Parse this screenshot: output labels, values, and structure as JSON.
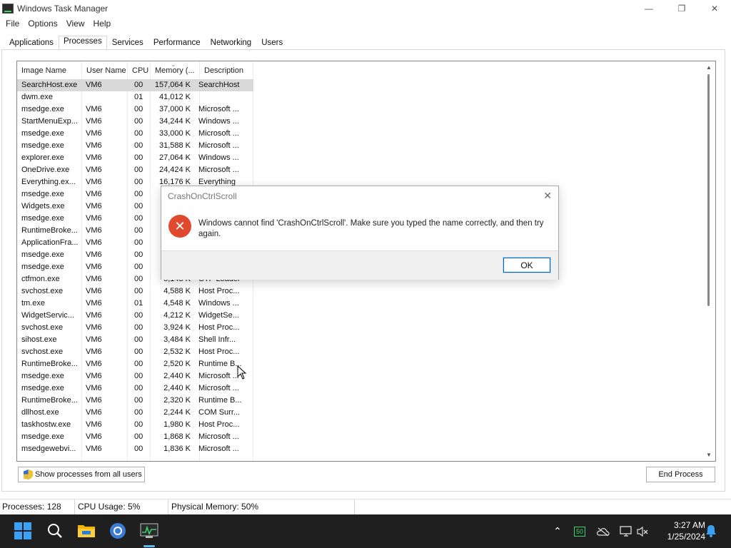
{
  "window": {
    "title": "Windows Task Manager",
    "controls": {
      "minimize": "—",
      "maximize": "❐",
      "close": "✕"
    }
  },
  "menu": [
    "File",
    "Options",
    "View",
    "Help"
  ],
  "tabs": [
    "Applications",
    "Processes",
    "Services",
    "Performance",
    "Networking",
    "Users"
  ],
  "active_tab": "Processes",
  "columns": {
    "image_name": "Image Name",
    "user_name": "User Name",
    "cpu": "CPU",
    "memory": "Memory (...",
    "description": "Description"
  },
  "processes": [
    {
      "name": "SearchHost.exe",
      "user": "VM6",
      "cpu": "00",
      "mem": "157,064 K",
      "desc": "SearchHost",
      "selected": true
    },
    {
      "name": "dwm.exe",
      "user": "",
      "cpu": "01",
      "mem": "41,012 K",
      "desc": ""
    },
    {
      "name": "msedge.exe",
      "user": "VM6",
      "cpu": "00",
      "mem": "37,000 K",
      "desc": "Microsoft ..."
    },
    {
      "name": "StartMenuExp...",
      "user": "VM6",
      "cpu": "00",
      "mem": "34,244 K",
      "desc": "Windows ..."
    },
    {
      "name": "msedge.exe",
      "user": "VM6",
      "cpu": "00",
      "mem": "33,000 K",
      "desc": "Microsoft ..."
    },
    {
      "name": "msedge.exe",
      "user": "VM6",
      "cpu": "00",
      "mem": "31,588 K",
      "desc": "Microsoft ..."
    },
    {
      "name": "explorer.exe",
      "user": "VM6",
      "cpu": "00",
      "mem": "27,064 K",
      "desc": "Windows ..."
    },
    {
      "name": "OneDrive.exe",
      "user": "VM6",
      "cpu": "00",
      "mem": "24,424 K",
      "desc": "Microsoft ..."
    },
    {
      "name": "Everything.ex...",
      "user": "VM6",
      "cpu": "00",
      "mem": "16,176 K",
      "desc": "Everything"
    },
    {
      "name": "msedge.exe",
      "user": "VM6",
      "cpu": "00",
      "mem": "",
      "desc": ""
    },
    {
      "name": "Widgets.exe",
      "user": "VM6",
      "cpu": "00",
      "mem": "",
      "desc": ""
    },
    {
      "name": "msedge.exe",
      "user": "VM6",
      "cpu": "00",
      "mem": "",
      "desc": ""
    },
    {
      "name": "RuntimeBroke...",
      "user": "VM6",
      "cpu": "00",
      "mem": "",
      "desc": ""
    },
    {
      "name": "ApplicationFra...",
      "user": "VM6",
      "cpu": "00",
      "mem": "",
      "desc": ""
    },
    {
      "name": "msedge.exe",
      "user": "VM6",
      "cpu": "00",
      "mem": "",
      "desc": ""
    },
    {
      "name": "msedge.exe",
      "user": "VM6",
      "cpu": "00",
      "mem": "",
      "desc": ""
    },
    {
      "name": "ctfmon.exe",
      "user": "VM6",
      "cpu": "00",
      "mem": "5,148 K",
      "desc": "CTF Loader"
    },
    {
      "name": "svchost.exe",
      "user": "VM6",
      "cpu": "00",
      "mem": "4,588 K",
      "desc": "Host Proc..."
    },
    {
      "name": "tm.exe",
      "user": "VM6",
      "cpu": "01",
      "mem": "4,548 K",
      "desc": "Windows ..."
    },
    {
      "name": "WidgetServic...",
      "user": "VM6",
      "cpu": "00",
      "mem": "4,212 K",
      "desc": "WidgetSe..."
    },
    {
      "name": "svchost.exe",
      "user": "VM6",
      "cpu": "00",
      "mem": "3,924 K",
      "desc": "Host Proc..."
    },
    {
      "name": "sihost.exe",
      "user": "VM6",
      "cpu": "00",
      "mem": "3,484 K",
      "desc": "Shell Infr..."
    },
    {
      "name": "svchost.exe",
      "user": "VM6",
      "cpu": "00",
      "mem": "2,532 K",
      "desc": "Host Proc..."
    },
    {
      "name": "RuntimeBroke...",
      "user": "VM6",
      "cpu": "00",
      "mem": "2,520 K",
      "desc": "Runtime B..."
    },
    {
      "name": "msedge.exe",
      "user": "VM6",
      "cpu": "00",
      "mem": "2,440 K",
      "desc": "Microsoft ..."
    },
    {
      "name": "msedge.exe",
      "user": "VM6",
      "cpu": "00",
      "mem": "2,440 K",
      "desc": "Microsoft ..."
    },
    {
      "name": "RuntimeBroke...",
      "user": "VM6",
      "cpu": "00",
      "mem": "2,320 K",
      "desc": "Runtime B..."
    },
    {
      "name": "dllhost.exe",
      "user": "VM6",
      "cpu": "00",
      "mem": "2,244 K",
      "desc": "COM Surr..."
    },
    {
      "name": "taskhostw.exe",
      "user": "VM6",
      "cpu": "00",
      "mem": "1,980 K",
      "desc": "Host Proc..."
    },
    {
      "name": "msedge.exe",
      "user": "VM6",
      "cpu": "00",
      "mem": "1,868 K",
      "desc": "Microsoft ..."
    },
    {
      "name": "msedgewebvi...",
      "user": "VM6",
      "cpu": "00",
      "mem": "1,836 K",
      "desc": "Microsoft ..."
    }
  ],
  "buttons": {
    "show_all": "Show processes from all users",
    "end_process": "End Process"
  },
  "status": {
    "processes": "Processes: 128",
    "cpu": "CPU Usage: 5%",
    "memory": "Physical Memory: 50%"
  },
  "dialog": {
    "title": "CrashOnCtrlScroll",
    "message": "Windows cannot find 'CrashOnCtrlScroll'. Make sure you typed the name correctly, and then try again.",
    "ok": "OK",
    "close": "✕",
    "icon": "error-icon"
  },
  "taskbar": {
    "time": "3:27 AM",
    "date": "1/25/2024",
    "tray_badge": "50",
    "icons": [
      "windows-start-icon",
      "search-icon",
      "file-explorer-icon",
      "chrome-icon",
      "task-manager-icon"
    ]
  },
  "colors": {
    "error_red": "#e0492e",
    "selected_row": "#d9d9d9",
    "taskbar": "#1f1f1f",
    "ok_border": "#0067c0"
  }
}
